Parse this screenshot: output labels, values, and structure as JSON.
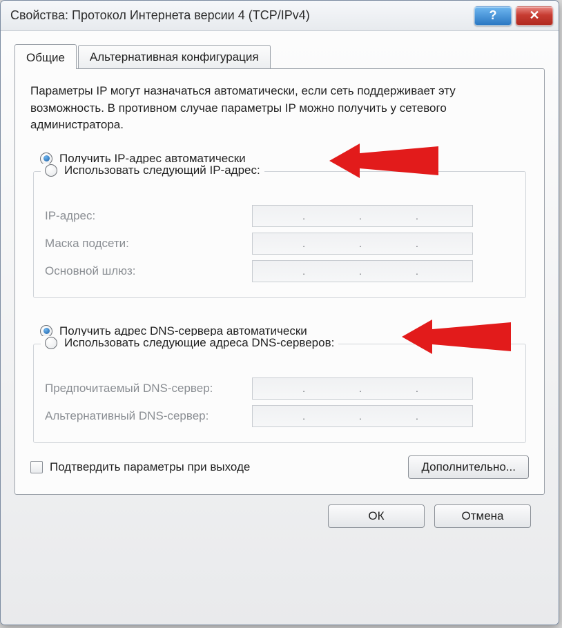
{
  "window": {
    "title": "Свойства: Протокол Интернета версии 4 (TCP/IPv4)",
    "help_glyph": "?",
    "close_glyph": "✕"
  },
  "tabs": {
    "general": "Общие",
    "alt": "Альтернативная конфигурация"
  },
  "hint": "Параметры IP могут назначаться автоматически, если сеть поддерживает эту возможность. В противном случае параметры IP можно получить у сетевого администратора.",
  "ip": {
    "auto": "Получить IP-адрес автоматически",
    "manual": "Использовать следующий IP-адрес:",
    "fields": {
      "ip": "IP-адрес:",
      "mask": "Маска подсети:",
      "gw": "Основной шлюз:"
    }
  },
  "dns": {
    "auto": "Получить адрес DNS-сервера автоматически",
    "manual": "Использовать следующие адреса DNS-серверов:",
    "fields": {
      "pref": "Предпочитаемый DNS-сервер:",
      "alt": "Альтернативный DNS-сервер:"
    }
  },
  "validate": "Подтвердить параметры при выходе",
  "buttons": {
    "advanced": "Дополнительно...",
    "ok": "ОК",
    "cancel": "Отмена"
  },
  "ip_placeholder": ". . ."
}
